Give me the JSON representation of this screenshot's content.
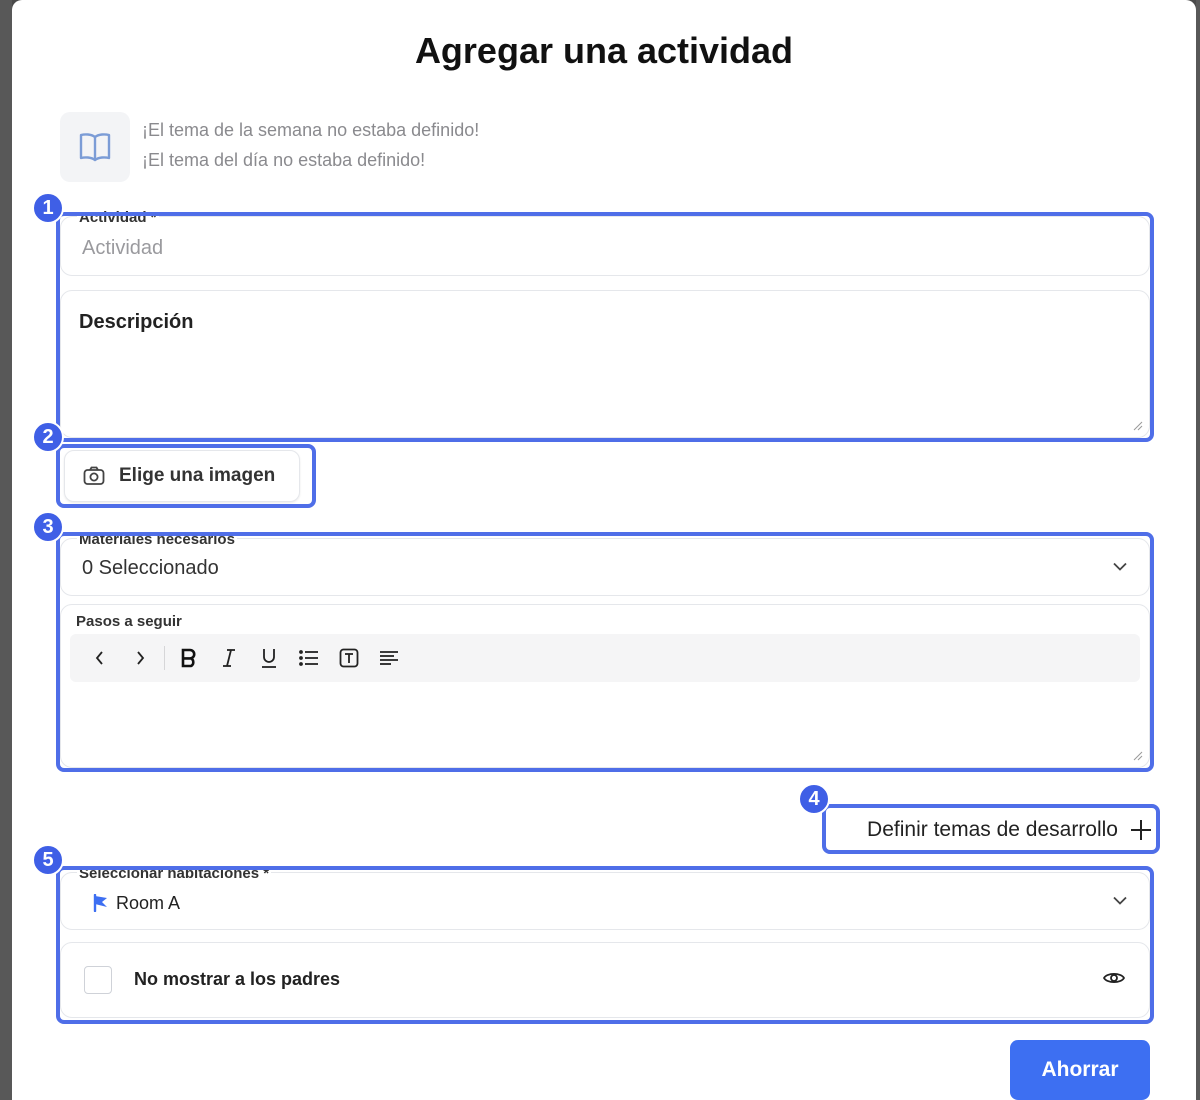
{
  "modal": {
    "title": "Agregar una actividad"
  },
  "themes": {
    "icon": "book-open-icon",
    "week_theme": "¡El tema de la semana no estaba definido!",
    "day_theme": "¡El tema del día no estaba definido!"
  },
  "activity": {
    "label": "Actividad *",
    "placeholder": "Actividad",
    "value": ""
  },
  "description": {
    "placeholder": "Descripción",
    "value": ""
  },
  "image": {
    "icon": "camera-icon",
    "button_label": "Elige una imagen"
  },
  "materials": {
    "label": "Materiales necesarios",
    "selected_text": "0 Seleccionado",
    "icon": "chevron-down-icon"
  },
  "steps": {
    "label": "Pasos a seguir",
    "value": "",
    "toolbar": [
      {
        "name": "undo",
        "icon": "chevron-left-icon"
      },
      {
        "name": "redo",
        "icon": "chevron-right-icon"
      },
      {
        "name": "bold",
        "icon": "bold-icon"
      },
      {
        "name": "italic",
        "icon": "italic-icon"
      },
      {
        "name": "underline",
        "icon": "underline-icon"
      },
      {
        "name": "list",
        "icon": "list-icon"
      },
      {
        "name": "text",
        "icon": "text-box-icon"
      },
      {
        "name": "align",
        "icon": "align-left-icon"
      }
    ]
  },
  "development": {
    "link_label": "Definir temas de desarrollo",
    "icon": "plus-icon"
  },
  "rooms": {
    "label": "Seleccionar habitaciones *",
    "selected": [
      {
        "label": "Room A",
        "icon": "flag-icon"
      }
    ],
    "icon": "chevron-down-icon"
  },
  "parents": {
    "label": "No mostrar a los padres",
    "checked": false,
    "icon": "eye-icon"
  },
  "save": {
    "label": "Ahorrar"
  },
  "annotations": [
    "1",
    "2",
    "3",
    "4",
    "5"
  ],
  "colors": {
    "accent": "#3d6ff2",
    "annotation": "#4f6ee8",
    "flag": "#3d6ff2"
  }
}
